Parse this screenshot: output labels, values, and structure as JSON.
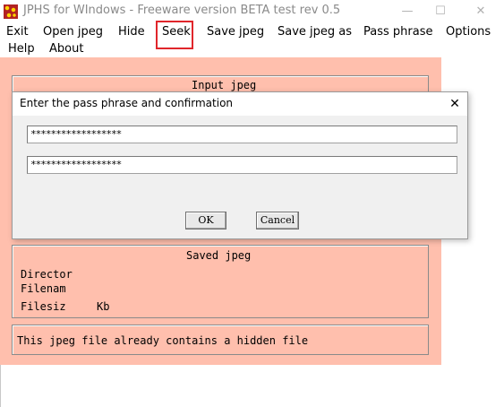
{
  "window": {
    "title": "JPHS for WIndows - Freeware version BETA test rev 0.5",
    "controls": {
      "minimize": "—",
      "maximize": "☐",
      "close": "✕"
    }
  },
  "menu": {
    "items": [
      "Exit",
      "Open jpeg",
      "Hide",
      "Seek",
      "Save jpeg",
      "Save jpeg as",
      "Pass phrase",
      "Options",
      "Help",
      "About"
    ],
    "highlighted": "Seek",
    "highlight_color": "#e0262b"
  },
  "main": {
    "background_color": "#ffbfad",
    "input_section": {
      "title": "Input jpeg"
    },
    "saved_section": {
      "title": "Saved jpeg",
      "directory_label": "Director",
      "filename_label": "Filenam",
      "filesize_label": "Filesiz",
      "filesize_unit": "Kb"
    },
    "status_text": "This jpeg file already contains a hidden file"
  },
  "dialog": {
    "title": "Enter the pass phrase and confirmation",
    "close_label": "✕",
    "passphrase_value": "******************",
    "confirmation_value": "******************",
    "ok_label": "OK",
    "cancel_label": "Cancel"
  }
}
